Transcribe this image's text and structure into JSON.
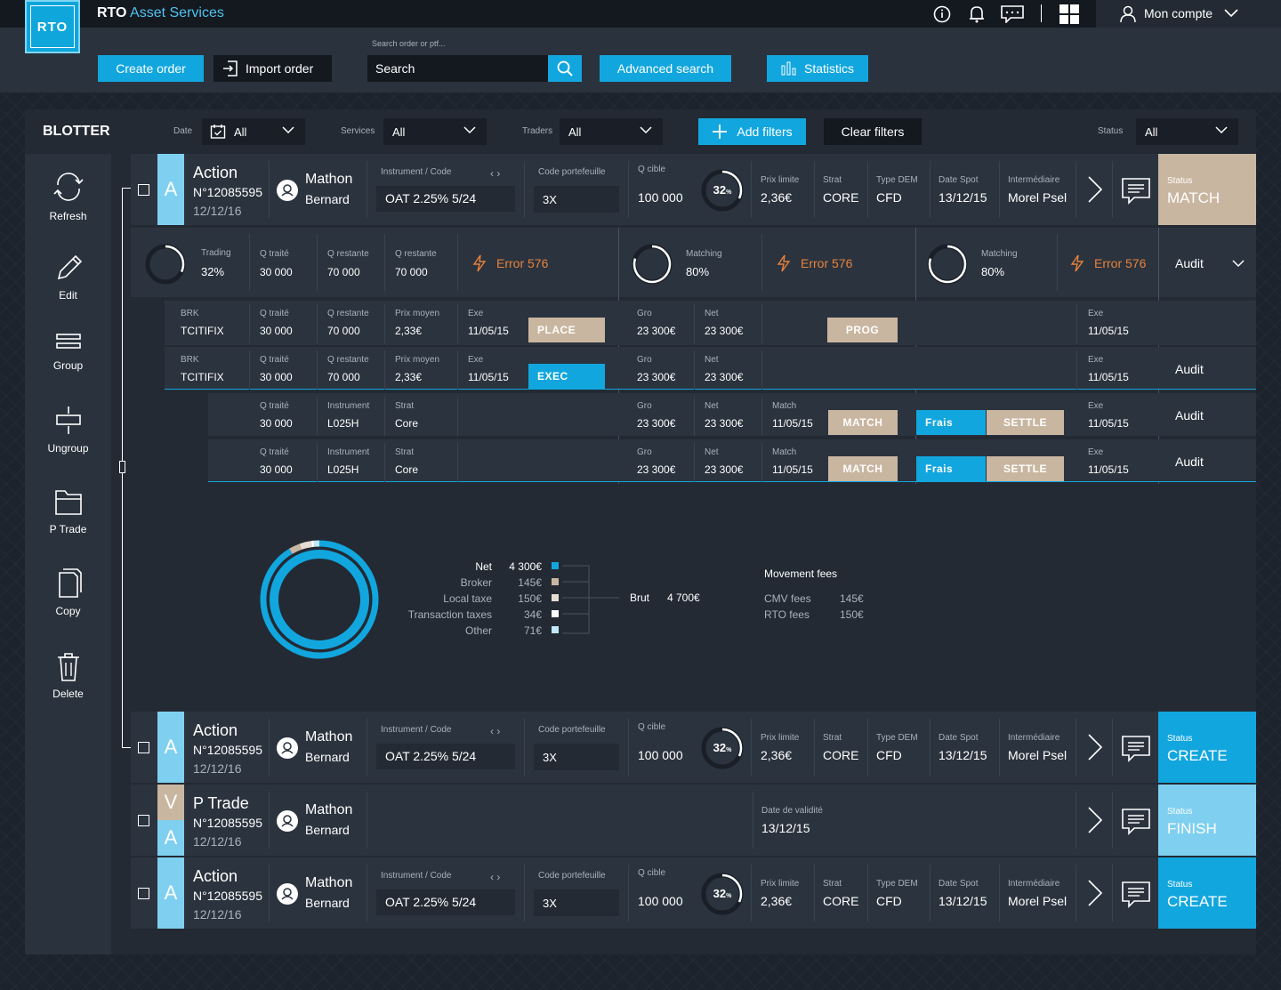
{
  "app": {
    "logo": "RTO",
    "title_bold": "RTO",
    "title_accent": "Asset Services",
    "account": "Mon compte"
  },
  "toolbar": {
    "create": "Create order",
    "import": "Import order",
    "search_label": "Search order or ptf...",
    "search_placeholder": "Search",
    "advanced": "Advanced search",
    "stats": "Statistics"
  },
  "blotter": {
    "title": "BLOTTER",
    "date_lbl": "Date",
    "date_val": "All",
    "services_lbl": "Services",
    "services_val": "All",
    "traders_lbl": "Traders",
    "traders_val": "All",
    "add_filters": "Add filters",
    "clear_filters": "Clear filters",
    "status_lbl": "Status",
    "status_val": "All"
  },
  "sidebar": [
    "Refresh",
    "Edit",
    "Group",
    "Ungroup",
    "P Trade",
    "Copy",
    "Delete"
  ],
  "labels": {
    "instrument": "Instrument / Code",
    "portefeuille": "Code portefeuille",
    "qcible": "Q cible",
    "prix": "Prix limite",
    "strat": "Strat",
    "type": "Type DEM",
    "date_spot": "Date Spot",
    "inter": "Intermédiaire",
    "status": "Status",
    "trading": "Trading",
    "qtraite": "Q traité",
    "qrestante": "Q restante",
    "matching": "Matching",
    "brk": "BRK",
    "prix_moyen": "Prix moyen",
    "exe": "Exe",
    "gro": "Gro",
    "net": "Net",
    "match": "Match",
    "instrument2": "Instrument",
    "validite": "Date de validité"
  },
  "order": {
    "type": "Action",
    "ptype": "P Trade",
    "num": "N°12085595",
    "date": "12/12/16",
    "first": "Mathon",
    "last": "Bernard",
    "instrument": "OAT 2.25% 5/24",
    "ptf": "3X",
    "qcible": "100 000",
    "pct": "32",
    "pct_sym": "%",
    "prix": "2,36€",
    "strat": "CORE",
    "type_dem": "CFD",
    "date_spot": "13/12/15",
    "inter": "Morel Psel",
    "validite": "13/12/15"
  },
  "statuses": {
    "match": "MATCH",
    "create": "CREATE",
    "finish": "FINISH"
  },
  "detail": {
    "trading_pct": "32%",
    "qtraite": "30 000",
    "qrestante": "70 000",
    "error": "Error 576",
    "matching_pct": "80%",
    "audit": "Audit",
    "brk": "TCITIFIX",
    "prix_moyen": "2,33€",
    "exe": "11/05/15",
    "place": "PLACE",
    "exec": "EXEC",
    "prog": "PROG",
    "gro": "23 300€",
    "net": "23 300€",
    "instr": "L025H",
    "strat": "Core",
    "match": "MATCH",
    "frais": "Frais",
    "settle": "SETTLE",
    "stripe_a": "A",
    "stripe_v": "V"
  },
  "fees": {
    "net_l": "Net",
    "net_v": "4 300€",
    "broker_l": "Broker",
    "broker_v": "145€",
    "local_l": "Local taxe",
    "local_v": "150€",
    "trans_l": "Transaction taxes",
    "trans_v": "34€",
    "other_l": "Other",
    "other_v": "71€",
    "brut_l": "Brut",
    "brut_v": "4 700€",
    "mv_title": "Movement fees",
    "cmv_l": "CMV fees",
    "cmv_v": "145€",
    "rto_l": "RTO fees",
    "rto_v": "150€"
  },
  "colors": {
    "accent": "#12a6de",
    "sand": "#c9b6a0",
    "light": "#7fd0f0",
    "error": "#e8823b"
  }
}
